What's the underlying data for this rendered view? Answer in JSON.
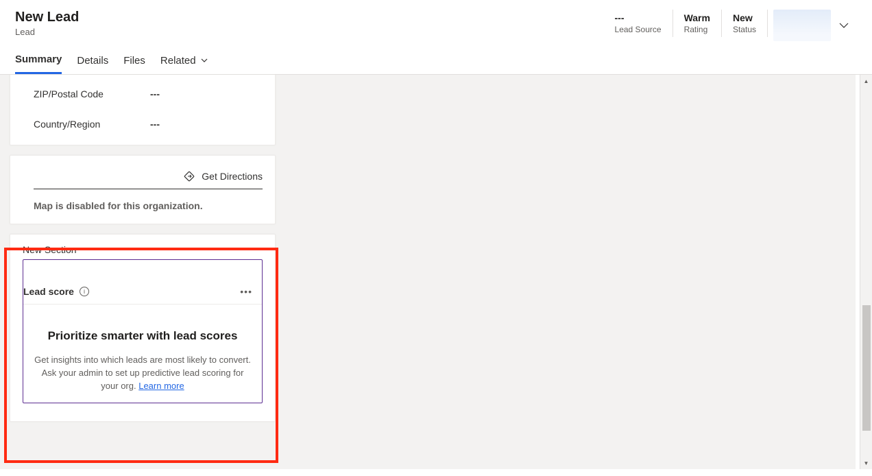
{
  "header": {
    "title": "New Lead",
    "subtitle": "Lead",
    "meta": [
      {
        "value": "---",
        "label": "Lead Source"
      },
      {
        "value": "Warm",
        "label": "Rating"
      },
      {
        "value": "New",
        "label": "Status"
      }
    ]
  },
  "tabs": {
    "summary": "Summary",
    "details": "Details",
    "files": "Files",
    "related": "Related"
  },
  "address": {
    "zip_label": "ZIP/Postal Code",
    "zip_value": "---",
    "country_label": "Country/Region",
    "country_value": "---"
  },
  "map": {
    "directions": "Get Directions",
    "disabled_msg": "Map is disabled for this organization."
  },
  "new_section": {
    "title": "New Section",
    "lead_score_label": "Lead score",
    "body_title": "Prioritize smarter with lead scores",
    "body_desc": "Get insights into which leads are most likely to convert. Ask your admin to set up predictive lead scoring for your org. ",
    "learn_more": "Learn more"
  }
}
